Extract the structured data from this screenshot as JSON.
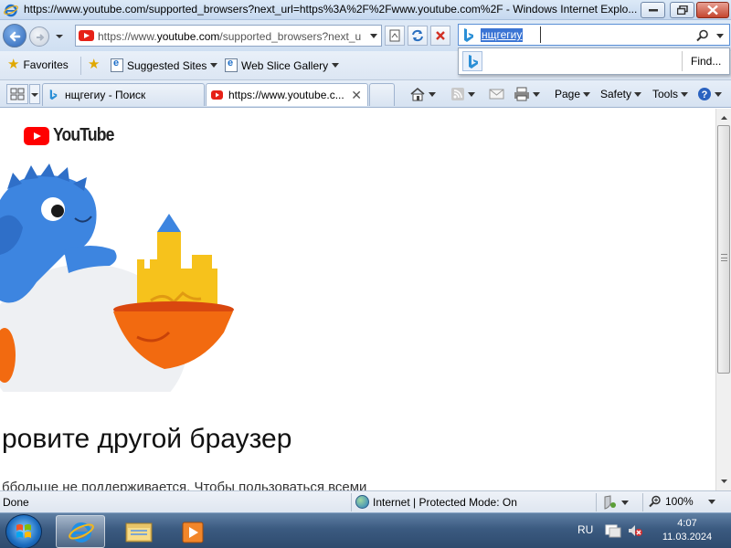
{
  "window": {
    "title": "https://www.youtube.com/supported_browsers?next_url=https%3A%2F%2Fwww.youtube.com%2F - Windows Internet Explo..."
  },
  "address": {
    "url_prefix": "https://www.",
    "url_domain": "youtube.com",
    "url_suffix": "/supported_browsers?next_u"
  },
  "search": {
    "query": "нщгегиу",
    "find_label": "Find..."
  },
  "favorites": {
    "favorites_label": "Favorites",
    "suggested_sites": "Suggested Sites",
    "web_slice_gallery": "Web Slice Gallery"
  },
  "tabs": [
    {
      "label": "нщгегиу - Поиск",
      "active": false
    },
    {
      "label": "https://www.youtube.c...",
      "active": true
    }
  ],
  "command_bar": {
    "page": "Page",
    "safety": "Safety",
    "tools": "Tools"
  },
  "content": {
    "logo_text": "YouTube",
    "heading": "ровите другой браузер",
    "subtext": "ббольше не поддерживается. Чтобы пользоваться всеми"
  },
  "statusbar": {
    "status": "Done",
    "zone": "Internet | Protected Mode: On",
    "zoom": "100%"
  },
  "taskbar": {
    "language": "RU",
    "time": "4:07",
    "date": "11.03.2024"
  },
  "colors": {
    "youtube_red": "#ff0000",
    "selection_blue": "#3a74d4",
    "taskbar": "#3b5a80"
  }
}
